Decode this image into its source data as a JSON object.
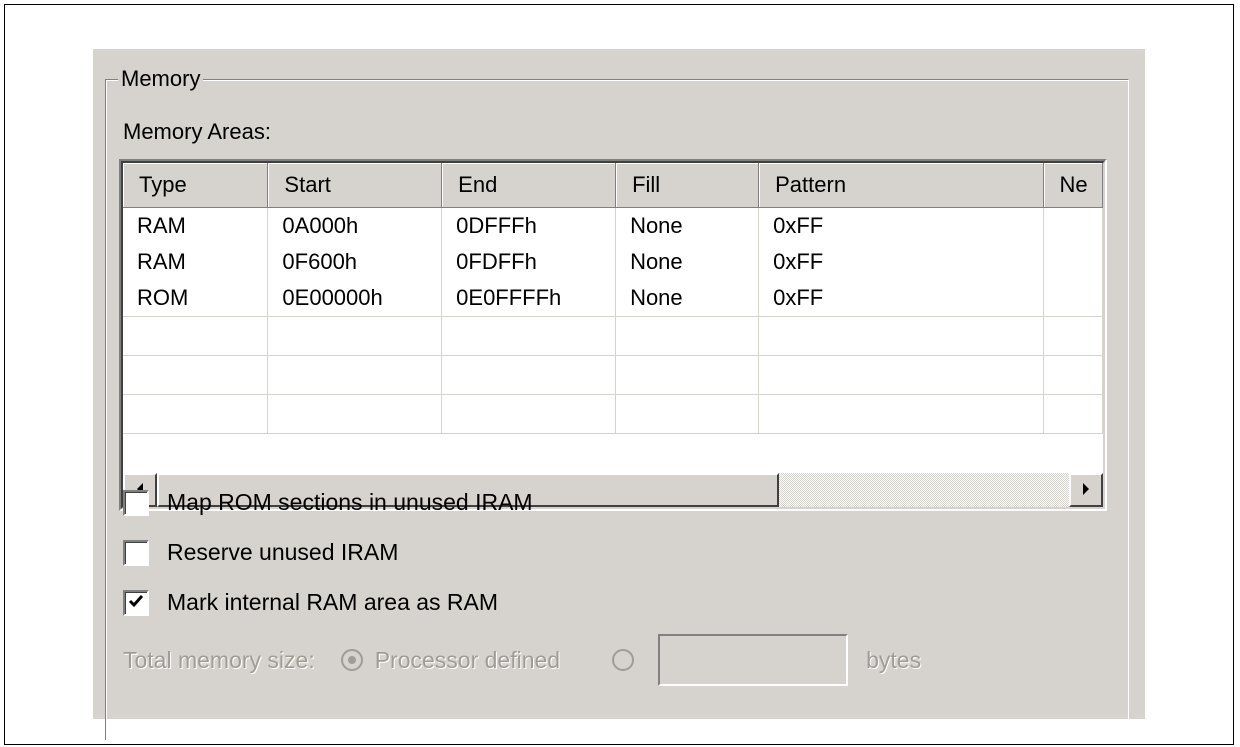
{
  "group": {
    "title": "Memory"
  },
  "areas_label": "Memory Areas:",
  "table": {
    "columns": [
      "Type",
      "Start",
      "End",
      "Fill",
      "Pattern",
      "Ne"
    ],
    "rows": [
      [
        "RAM",
        "0A000h",
        "0DFFFh",
        "None",
        "0xFF",
        ""
      ],
      [
        "RAM",
        "0F600h",
        "0FDFFh",
        "None",
        "0xFF",
        ""
      ],
      [
        "ROM",
        "0E00000h",
        "0E0FFFFh",
        "None",
        "0xFF",
        ""
      ],
      [
        "",
        "",
        "",
        "",
        "",
        ""
      ],
      [
        "",
        "",
        "",
        "",
        "",
        ""
      ],
      [
        "",
        "",
        "",
        "",
        "",
        ""
      ]
    ]
  },
  "options": {
    "map_rom": {
      "label": "Map ROM sections in unused IRAM",
      "checked": false
    },
    "reserve_iram": {
      "label": "Reserve unused IRAM",
      "checked": false
    },
    "mark_internal": {
      "label": "Mark internal RAM area as RAM",
      "checked": true
    }
  },
  "total_memory": {
    "label": "Total memory size:",
    "processor_defined_label": "Processor defined",
    "selected": "processor_defined",
    "bytes_value": "",
    "bytes_label": "bytes"
  },
  "icons": {
    "scroll_left": "arrow-left-icon",
    "scroll_right": "arrow-right-icon",
    "check": "checkmark-icon"
  }
}
